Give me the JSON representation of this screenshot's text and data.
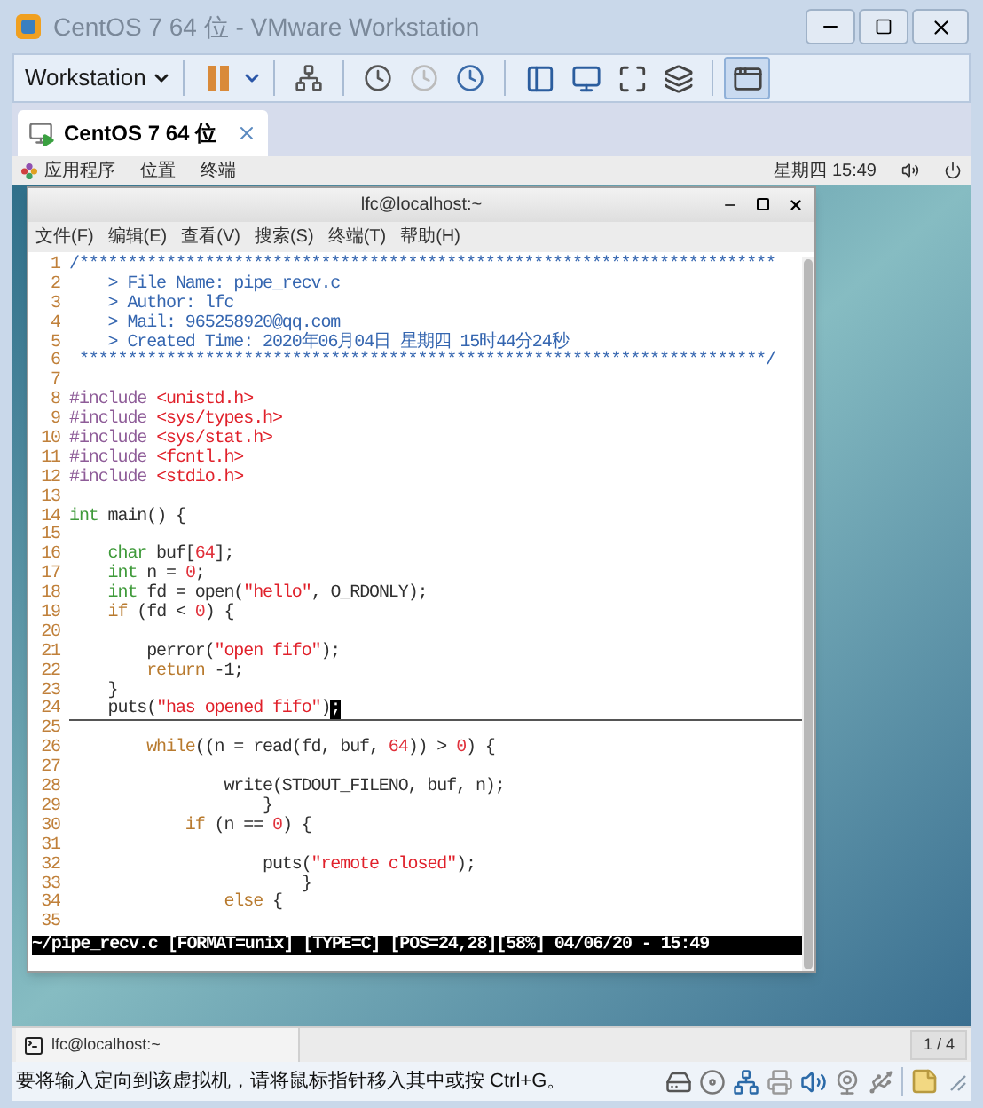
{
  "window": {
    "title": "CentOS 7 64 位 - VMware Workstation"
  },
  "toolbar": {
    "menu_label": "Workstation"
  },
  "tabs": [
    {
      "label": "CentOS 7 64 位",
      "selected": true
    }
  ],
  "guest": {
    "top_bar": {
      "menus": [
        "应用程序",
        "位置",
        "终端"
      ],
      "clock": "星期四 15:49"
    },
    "terminal": {
      "title": "lfc@localhost:~",
      "menus": [
        "文件(F)",
        "编辑(E)",
        "查看(V)",
        "搜索(S)",
        "终端(T)",
        "帮助(H)"
      ],
      "lines": [
        {
          "number": "1",
          "segments": [
            {
              "kind": "comment",
              "text": "/************************************************************************"
            }
          ]
        },
        {
          "number": "2",
          "segments": [
            {
              "kind": "comment",
              "text": "    > File Name: pipe_recv.c"
            }
          ]
        },
        {
          "number": "3",
          "segments": [
            {
              "kind": "comment",
              "text": "    > Author: lfc"
            }
          ]
        },
        {
          "number": "4",
          "segments": [
            {
              "kind": "comment",
              "text": "    > Mail: 965258920@qq.com"
            }
          ]
        },
        {
          "number": "5",
          "segments": [
            {
              "kind": "comment",
              "text": "    > Created Time: 2020年06月04日 星期四 15时44分24秒"
            }
          ]
        },
        {
          "number": "6",
          "segments": [
            {
              "kind": "comment",
              "text": " ***********************************************************************/"
            }
          ]
        },
        {
          "number": "7"
        },
        {
          "number": "8",
          "segments": [
            {
              "kind": "preproc",
              "text": "#include "
            },
            {
              "kind": "string",
              "text": "<unistd.h>"
            }
          ]
        },
        {
          "number": "9",
          "segments": [
            {
              "kind": "preproc",
              "text": "#include "
            },
            {
              "kind": "string",
              "text": "<sys/types.h>"
            }
          ]
        },
        {
          "number": "10",
          "segments": [
            {
              "kind": "preproc",
              "text": "#include "
            },
            {
              "kind": "string",
              "text": "<sys/stat.h>"
            }
          ]
        },
        {
          "number": "11",
          "segments": [
            {
              "kind": "preproc",
              "text": "#include "
            },
            {
              "kind": "string",
              "text": "<fcntl.h>"
            }
          ]
        },
        {
          "number": "12",
          "segments": [
            {
              "kind": "preproc",
              "text": "#include "
            },
            {
              "kind": "string",
              "text": "<stdio.h>"
            }
          ]
        },
        {
          "number": "13"
        },
        {
          "number": "14",
          "segments": [
            {
              "kind": "type",
              "text": "int"
            },
            {
              "kind": "plain",
              "text": " main() {"
            }
          ]
        },
        {
          "number": "15"
        },
        {
          "number": "16",
          "segments": [
            {
              "kind": "type",
              "text": "    char"
            },
            {
              "kind": "plain",
              "text": " buf["
            },
            {
              "kind": "number",
              "text": "64"
            },
            {
              "kind": "plain",
              "text": "];"
            }
          ]
        },
        {
          "number": "17",
          "segments": [
            {
              "kind": "type",
              "text": "    int"
            },
            {
              "kind": "plain",
              "text": " n = "
            },
            {
              "kind": "number",
              "text": "0"
            },
            {
              "kind": "plain",
              "text": ";"
            }
          ]
        },
        {
          "number": "18",
          "segments": [
            {
              "kind": "type",
              "text": "    int"
            },
            {
              "kind": "plain",
              "text": " fd = open("
            },
            {
              "kind": "string",
              "text": "\"hello\""
            },
            {
              "kind": "plain",
              "text": ", O_RDONLY);"
            }
          ]
        },
        {
          "number": "19",
          "segments": [
            {
              "kind": "keyword",
              "text": "    if"
            },
            {
              "kind": "plain",
              "text": " (fd < "
            },
            {
              "kind": "number",
              "text": "0"
            },
            {
              "kind": "plain",
              "text": ") {"
            }
          ]
        },
        {
          "number": "20"
        },
        {
          "number": "21",
          "segments": [
            {
              "kind": "plain",
              "text": "        perror("
            },
            {
              "kind": "string",
              "text": "\"open fifo\""
            },
            {
              "kind": "plain",
              "text": ");"
            }
          ]
        },
        {
          "number": "22",
          "segments": [
            {
              "kind": "keyword",
              "text": "        return"
            },
            {
              "kind": "plain",
              "text": " -1;"
            }
          ]
        },
        {
          "number": "23",
          "segments": [
            {
              "kind": "plain",
              "text": "    }"
            }
          ]
        },
        {
          "number": "24",
          "segments": [
            {
              "kind": "plain",
              "text": "    puts("
            },
            {
              "kind": "string",
              "text": "\"has opened fifo\""
            },
            {
              "kind": "plain",
              "text": ")"
            },
            {
              "kind": "cursor",
              "text": ";"
            }
          ]
        },
        {
          "number": "25"
        },
        {
          "number": "26",
          "segments": [
            {
              "kind": "keyword",
              "text": "        while"
            },
            {
              "kind": "plain",
              "text": "((n = read(fd, buf, "
            },
            {
              "kind": "number",
              "text": "64"
            },
            {
              "kind": "plain",
              "text": ")) > "
            },
            {
              "kind": "number",
              "text": "0"
            },
            {
              "kind": "plain",
              "text": ") {"
            }
          ]
        },
        {
          "number": "27"
        },
        {
          "number": "28",
          "segments": [
            {
              "kind": "plain",
              "text": "                write(STDOUT_FILENO, buf, n);"
            }
          ]
        },
        {
          "number": "29",
          "segments": [
            {
              "kind": "plain",
              "text": "                    }"
            }
          ]
        },
        {
          "number": "30",
          "segments": [
            {
              "kind": "keyword",
              "text": "            if"
            },
            {
              "kind": "plain",
              "text": " (n == "
            },
            {
              "kind": "number",
              "text": "0"
            },
            {
              "kind": "plain",
              "text": ") {"
            }
          ]
        },
        {
          "number": "31"
        },
        {
          "number": "32",
          "segments": [
            {
              "kind": "plain",
              "text": "                    puts("
            },
            {
              "kind": "string",
              "text": "\"remote closed\""
            },
            {
              "kind": "plain",
              "text": ");"
            }
          ]
        },
        {
          "number": "33",
          "segments": [
            {
              "kind": "plain",
              "text": "                        }"
            }
          ]
        },
        {
          "number": "34",
          "segments": [
            {
              "kind": "keyword",
              "text": "                else"
            },
            {
              "kind": "plain",
              "text": " {"
            }
          ]
        },
        {
          "number": "35"
        }
      ],
      "status_line": "~/pipe_recv.c [FORMAT=unix] [TYPE=C] [POS=24,28][58%] 04/06/20 - 15:49"
    },
    "taskbar": {
      "items": [
        {
          "label": "lfc@localhost:~"
        }
      ],
      "workspace": "1 / 4"
    }
  },
  "status_bar": {
    "message": "要将输入定向到该虚拟机，请将鼠标指针移入其中或按 Ctrl+G。"
  }
}
